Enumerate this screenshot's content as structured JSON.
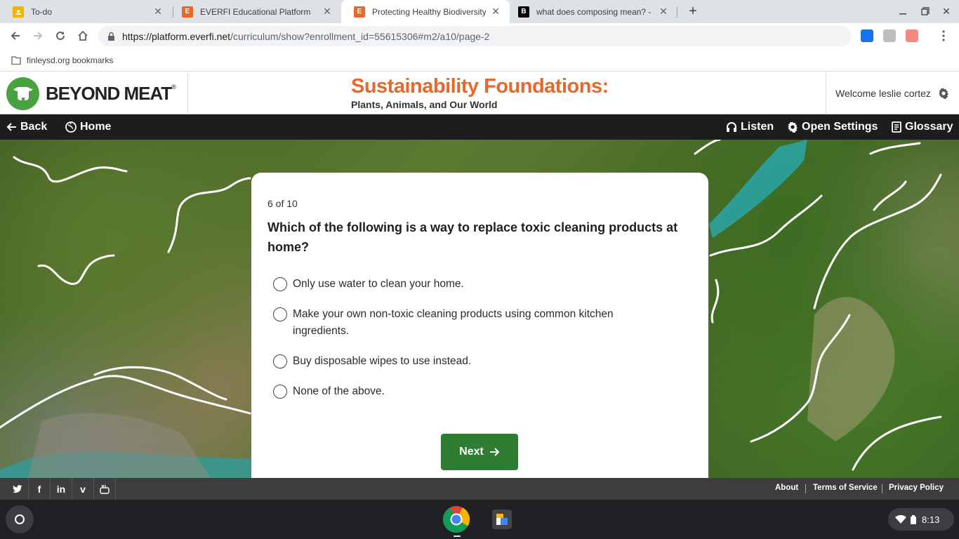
{
  "browser": {
    "tabs": [
      {
        "title": "To-do",
        "favicon": "google-classroom-icon",
        "color": "#f5b400"
      },
      {
        "title": "EVERFI Educational Platform",
        "favicon": "everfi-e-icon",
        "color": "#e8682a"
      },
      {
        "title": "Protecting Healthy Biodiversity | E",
        "favicon": "everfi-e-icon",
        "color": "#e8682a"
      },
      {
        "title": "what does composing mean? - B",
        "favicon": "brainly-b-icon",
        "color": "#000000"
      }
    ],
    "active_tab_index": 2,
    "url_host": "https://platform.everfi.net",
    "url_path": "/curriculum/show?enrollment_id=55615306#m2/a10/page-2",
    "bookmark_folder": "finleysd.org bookmarks"
  },
  "header": {
    "logo_text": "BEYOND MEAT",
    "logo_mark": "®",
    "course_title": "Sustainability Foundations:",
    "course_subtitle": "Plants, Animals, and Our World",
    "welcome": "Welcome leslie cortez"
  },
  "nav": {
    "back": "Back",
    "home": "Home",
    "listen": "Listen",
    "settings": "Open Settings",
    "glossary": "Glossary"
  },
  "quiz": {
    "progress": "6 of 10",
    "question": "Which of the following is a way to replace toxic cleaning products at home?",
    "options": [
      "Only use water to clean your home.",
      "Make your own non-toxic cleaning products using common kitchen ingredients.",
      "Buy disposable wipes to use instead.",
      "None of the above."
    ],
    "next_label": "Next"
  },
  "footer": {
    "social": [
      "twitter-icon",
      "facebook-icon",
      "linkedin-icon",
      "vimeo-icon",
      "youtube-icon"
    ],
    "links": [
      "About",
      "Terms of Service",
      "Privacy Policy"
    ]
  },
  "shelf": {
    "time": "8:13"
  },
  "colors": {
    "accent_orange": "#e8682a",
    "brand_green": "#48a23f",
    "next_button": "#2e7d32",
    "nav_bg": "#1d1d1d",
    "footer_bg": "#3d3d3d"
  }
}
